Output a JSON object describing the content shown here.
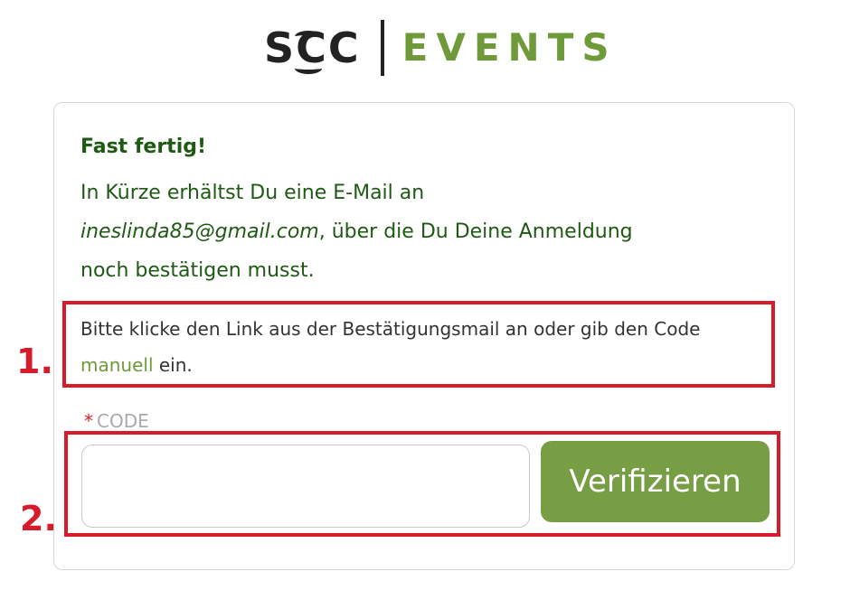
{
  "logo": {
    "brand_text": "SCC",
    "product_text": "EVENTS"
  },
  "message": {
    "title": "Fast fertig!",
    "line1": "In Kürze erhältst Du eine E-Mail an",
    "email": "ineslinda85@gmail.com",
    "line2_rest": ", über die Du Deine Anmeldung",
    "line3": "noch bestätigen musst."
  },
  "instruction": {
    "text_before_link": "Bitte klicke den Link aus der Bestätigungsmail an oder gib den Code ",
    "link_text": "manuell",
    "text_after_link": " ein."
  },
  "code_field": {
    "required_marker": "*",
    "label": "CODE",
    "value": "",
    "placeholder": ""
  },
  "verify_button": {
    "label": "Verifizieren"
  },
  "annotations": {
    "marker_1": "1.",
    "marker_2": "2."
  },
  "colors": {
    "brand_green": "#779e44",
    "message_green": "#1f5a14",
    "annotation_red": "#d81b2a"
  }
}
